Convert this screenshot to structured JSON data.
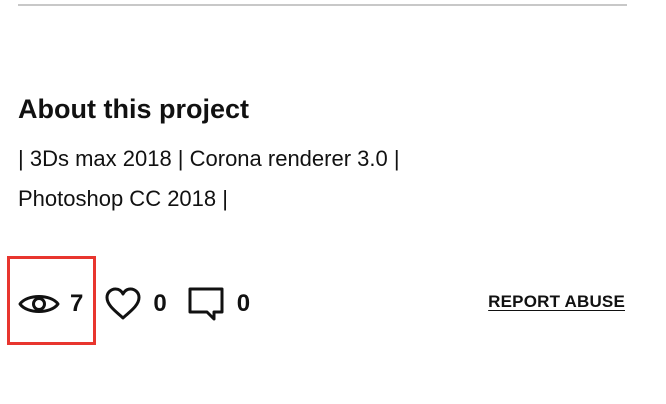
{
  "about": {
    "title": "About this project",
    "description_lines": [
      "| 3Ds max 2018 | Corona renderer 3.0 |",
      "Photoshop CC 2018 |"
    ]
  },
  "stats": {
    "views": {
      "icon": "eye-icon",
      "count": "7"
    },
    "likes": {
      "icon": "heart-icon",
      "count": "0"
    },
    "comments": {
      "icon": "comment-icon",
      "count": "0"
    }
  },
  "actions": {
    "report_label": "REPORT ABUSE"
  },
  "colors": {
    "text": "#111111",
    "divider": "#c8c8c8",
    "highlight": "#e8352e"
  }
}
